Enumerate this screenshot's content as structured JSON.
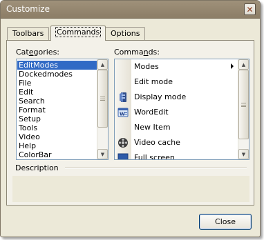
{
  "window": {
    "title": "Customize",
    "close_glyph": "✕"
  },
  "tabs": [
    {
      "label": "Toolbars"
    },
    {
      "label": "Commands"
    },
    {
      "label": "Options"
    }
  ],
  "categories": {
    "label_pre": "Cat",
    "label_mnemonic": "e",
    "label_post": "gories:",
    "items": [
      {
        "label": "EditModes"
      },
      {
        "label": "Dockedmodes"
      },
      {
        "label": "File"
      },
      {
        "label": "Edit"
      },
      {
        "label": "Search"
      },
      {
        "label": "Format"
      },
      {
        "label": "Setup"
      },
      {
        "label": "Tools"
      },
      {
        "label": "Video"
      },
      {
        "label": "Help"
      },
      {
        "label": "ColorBar"
      }
    ],
    "selected": "EditModes"
  },
  "commands": {
    "label_pre": "Comma",
    "label_mnemonic": "n",
    "label_post": "ds:",
    "items": [
      {
        "label": "Modes",
        "icon": "submenu-arrow-icon"
      },
      {
        "label": "Edit mode",
        "icon": ""
      },
      {
        "label": "Display mode",
        "icon": "display-mode-icon"
      },
      {
        "label": "WordEdit",
        "icon": "wordedit-icon"
      },
      {
        "label": "New Item",
        "icon": ""
      },
      {
        "label": "Video cache",
        "icon": "video-cache-icon"
      },
      {
        "label": "Full screen",
        "icon": "full-screen-icon"
      }
    ]
  },
  "description": {
    "label": "Description",
    "text": ""
  },
  "footer": {
    "close_label": "Close"
  },
  "colors": {
    "selection": "#316ac5",
    "titlebar": "#9f917a",
    "dialog_bg": "#ece9d8"
  }
}
